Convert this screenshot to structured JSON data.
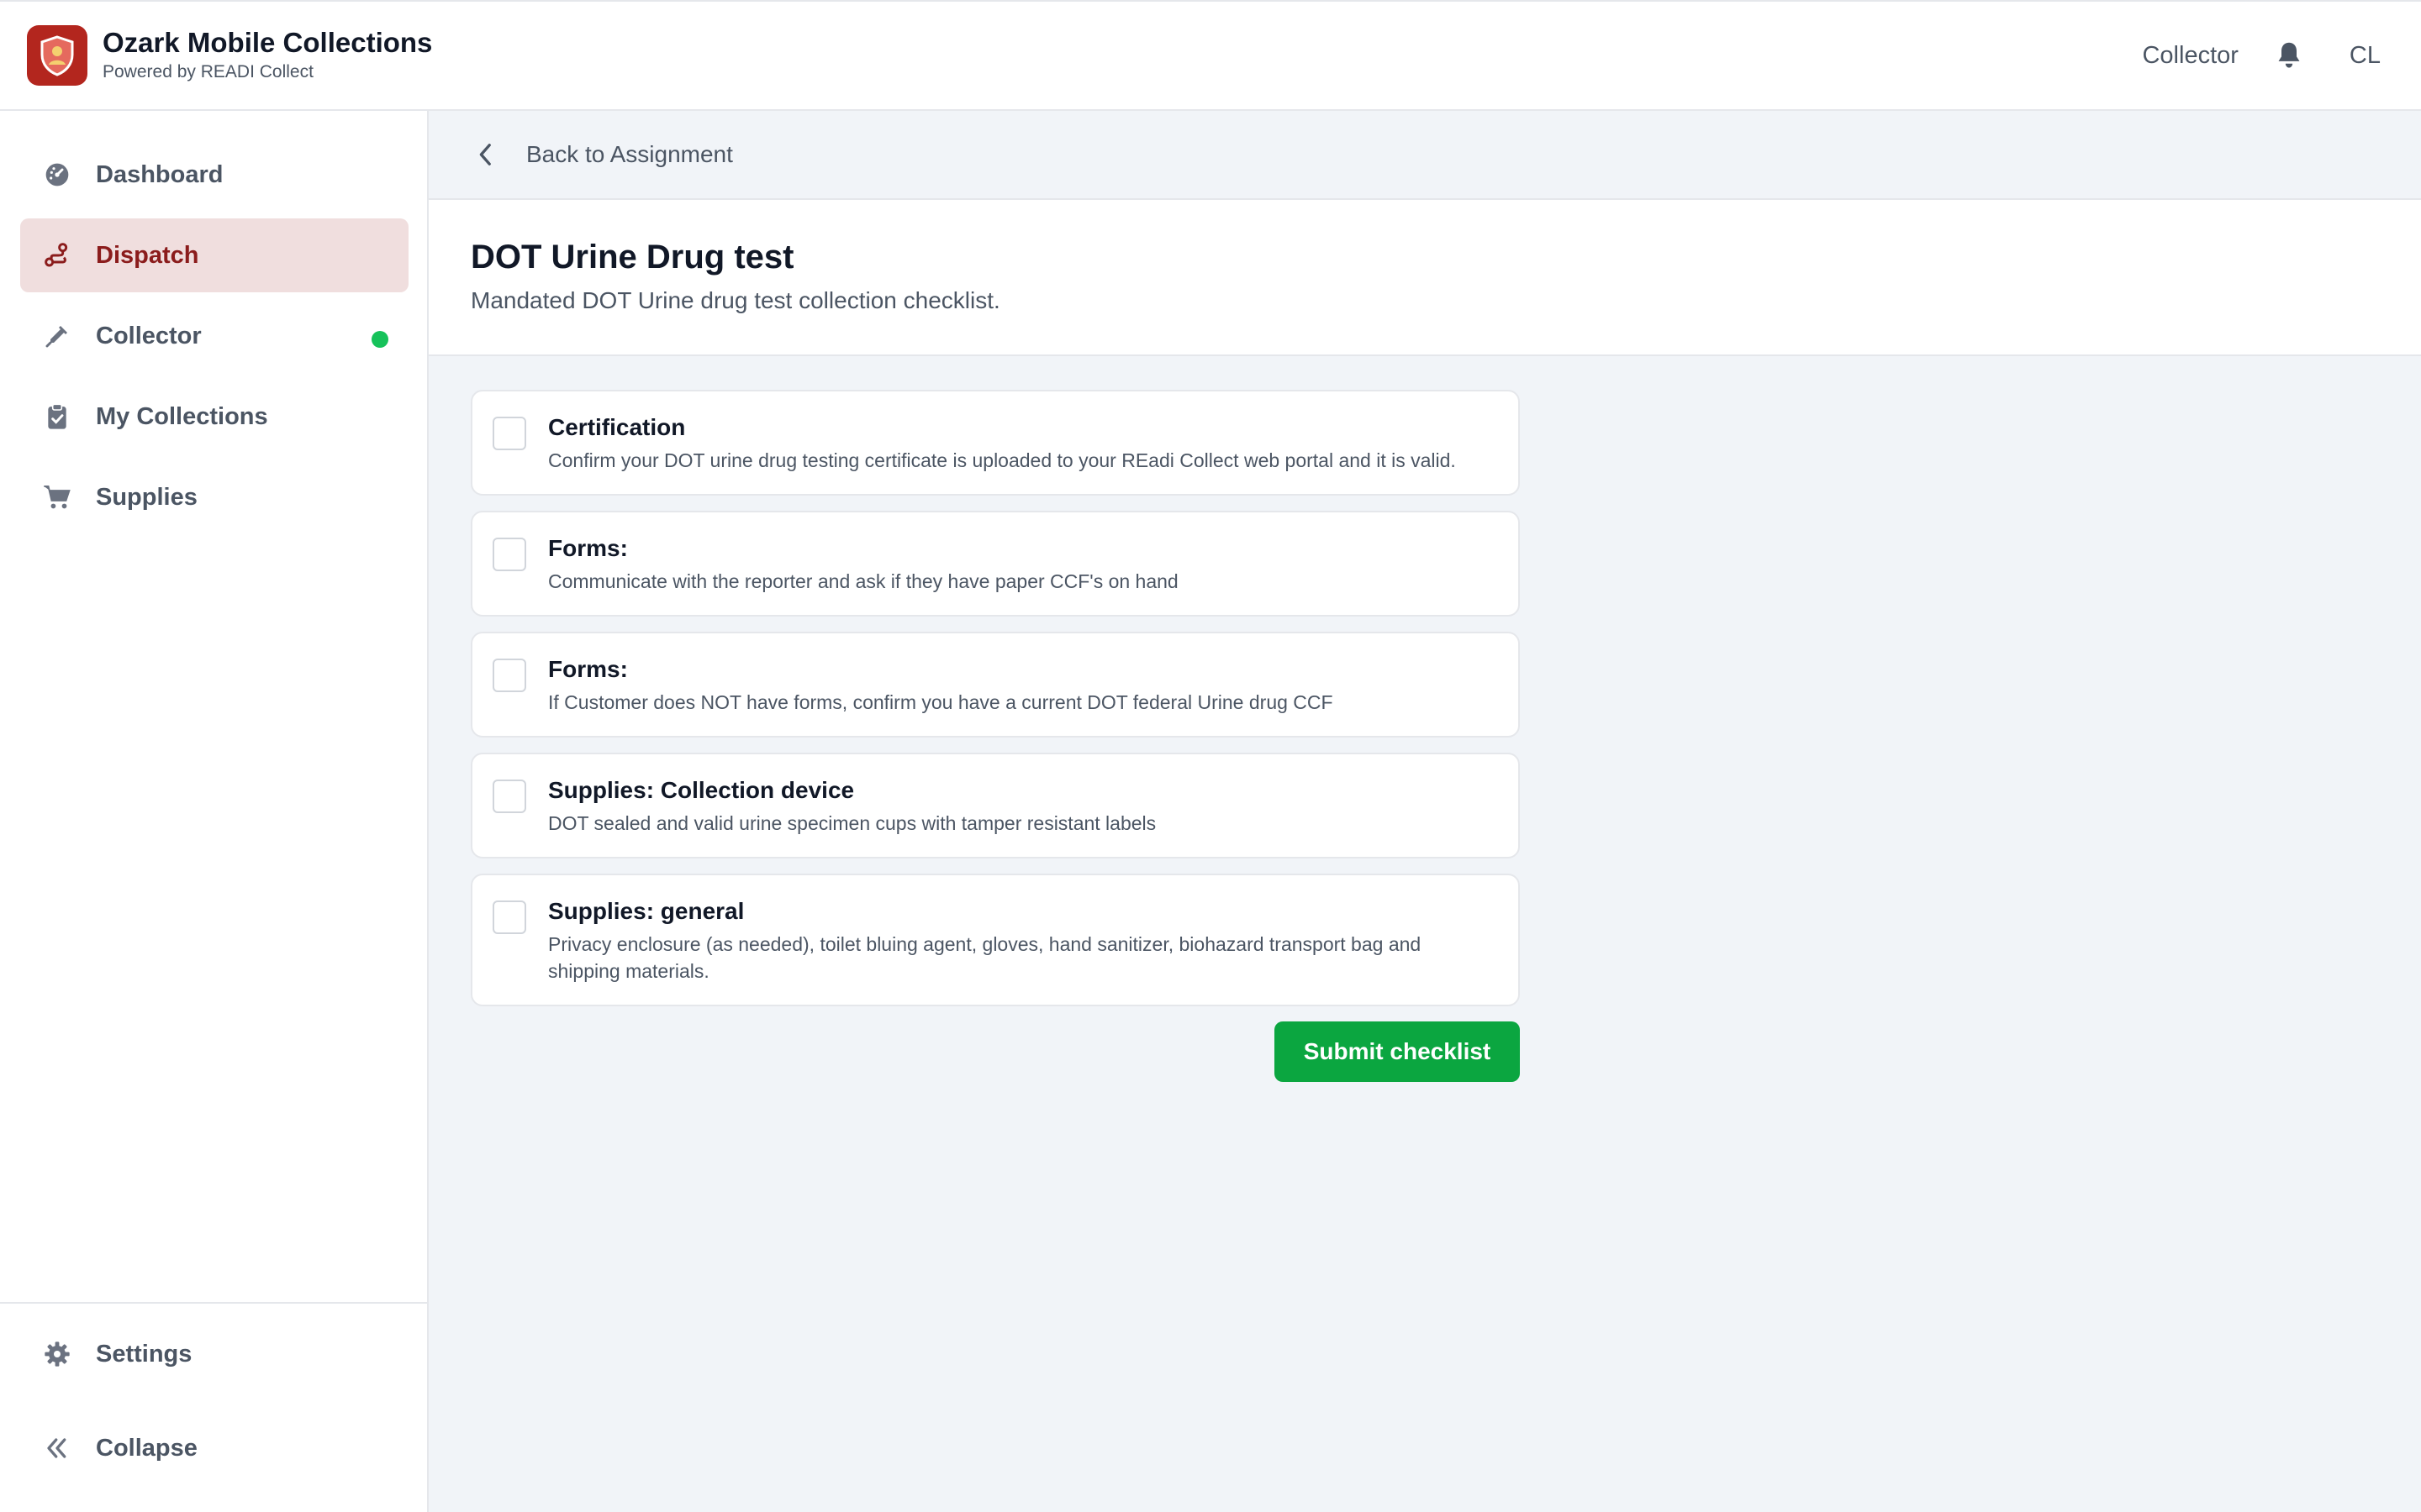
{
  "header": {
    "app_title": "Ozark Mobile Collections",
    "app_subtitle": "Powered by READI Collect",
    "role_label": "Collector",
    "user_initials": "CL",
    "logo_icon": "shield-person-icon",
    "bell_icon": "bell-icon"
  },
  "sidebar": {
    "items": [
      {
        "label": "Dashboard",
        "icon": "gauge-icon",
        "active": false
      },
      {
        "label": "Dispatch",
        "icon": "route-icon",
        "active": true
      },
      {
        "label": "Collector",
        "icon": "syringe-icon",
        "active": false,
        "status": "online"
      },
      {
        "label": "My Collections",
        "icon": "clipboard-check-icon",
        "active": false
      },
      {
        "label": "Supplies",
        "icon": "cart-icon",
        "active": false
      }
    ],
    "bottom": [
      {
        "label": "Settings",
        "icon": "gear-icon"
      },
      {
        "label": "Collapse",
        "icon": "double-chevron-left-icon"
      }
    ]
  },
  "main": {
    "back_label": "Back to Assignment",
    "title": "DOT Urine Drug test",
    "subtitle": "Mandated DOT Urine drug test collection checklist.",
    "checklist": [
      {
        "title": "Certification",
        "description": "Confirm your DOT urine drug testing certificate is uploaded to your REadi Collect web portal and it is valid.",
        "checked": false
      },
      {
        "title": "Forms:",
        "description": "Communicate with the reporter and ask if they have paper CCF's on hand",
        "checked": false
      },
      {
        "title": "Forms:",
        "description": "If Customer does NOT have forms, confirm you have a current DOT federal Urine drug CCF",
        "checked": false
      },
      {
        "title": "Supplies: Collection device",
        "description": "DOT sealed and valid urine specimen cups with tamper resistant labels",
        "checked": false
      },
      {
        "title": "Supplies: general",
        "description": "Privacy enclosure (as needed), toilet bluing agent, gloves, hand sanitizer, biohazard transport bag and shipping materials.",
        "checked": false
      }
    ],
    "submit_label": "Submit checklist"
  },
  "colors": {
    "brand": "#b3261e",
    "active_bg": "#f0dede",
    "active_text": "#8b1c1c",
    "submit": "#0ba640",
    "online": "#16c25a"
  }
}
